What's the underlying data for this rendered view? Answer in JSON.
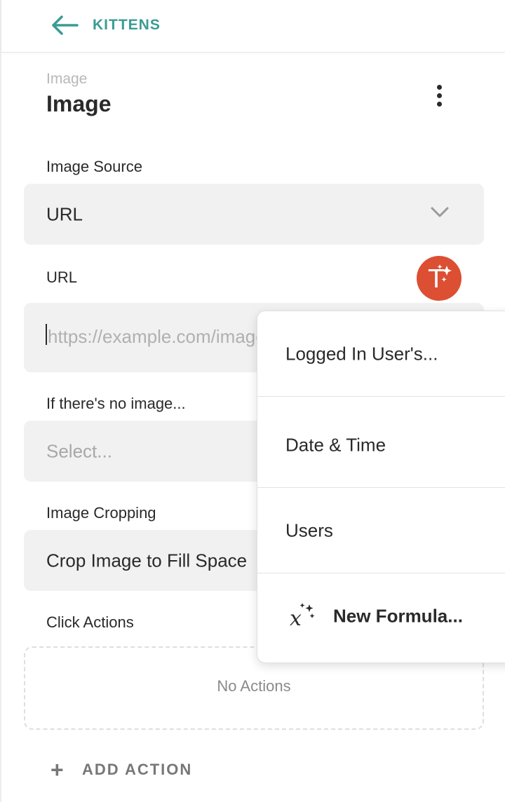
{
  "header": {
    "back_label": "KITTENS"
  },
  "component": {
    "type_label": "Image",
    "title": "Image"
  },
  "fields": {
    "image_source": {
      "label": "Image Source",
      "value": "URL"
    },
    "url": {
      "label": "URL",
      "placeholder": "https://example.com/image.jpg"
    },
    "no_image": {
      "label": "If there's no image...",
      "placeholder": "Select..."
    },
    "cropping": {
      "label": "Image Cropping",
      "value": "Crop Image to Fill Space"
    },
    "click_actions": {
      "label": "Click Actions",
      "empty_text": "No Actions",
      "add_label": "ADD ACTION"
    }
  },
  "magic_button": {
    "letter": "T"
  },
  "menu": {
    "items": [
      {
        "label": "Logged In User's..."
      },
      {
        "label": "Date & Time"
      },
      {
        "label": "Users"
      },
      {
        "label": "New Formula..."
      }
    ]
  },
  "colors": {
    "accent": "#3a9c93",
    "magic": "#dc4f33",
    "field_bg": "#f1f1f1"
  },
  "icons": {
    "back": "arrow-left-icon",
    "more": "kebab-menu-icon",
    "dropdown": "chevron-down-icon",
    "magic": "magic-text-icon",
    "formula": "formula-sparkle-icon",
    "add": "plus-icon"
  }
}
